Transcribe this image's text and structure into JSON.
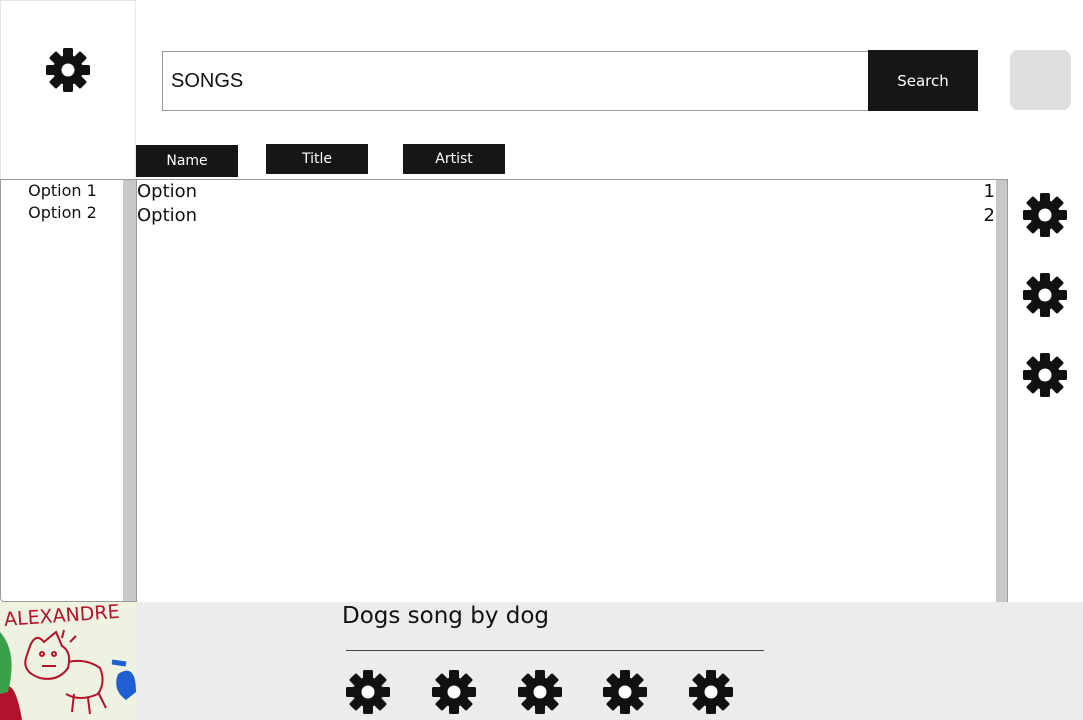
{
  "search": {
    "value": "SONGS",
    "button_label": "Search"
  },
  "columns": {
    "name": "Name",
    "title": "Title",
    "artist": "Artist"
  },
  "options": [
    "Option 1",
    "Option 2"
  ],
  "list": [
    {
      "name": "Option",
      "num": "1"
    },
    {
      "name": "Option",
      "num": "2"
    }
  ],
  "player": {
    "now_playing": "Dogs song by dog"
  },
  "album_art": {
    "caption": "ALEXANDRE"
  },
  "icons": {
    "sidebar": "gear-icon",
    "right": [
      "gear-icon",
      "gear-icon",
      "gear-icon"
    ],
    "controls": [
      "gear-icon",
      "gear-icon",
      "gear-icon",
      "gear-icon",
      "gear-icon"
    ]
  },
  "colors": {
    "button_bg": "#161616",
    "scrollbar": "#c8c8c8",
    "player_bg": "#ececec"
  }
}
